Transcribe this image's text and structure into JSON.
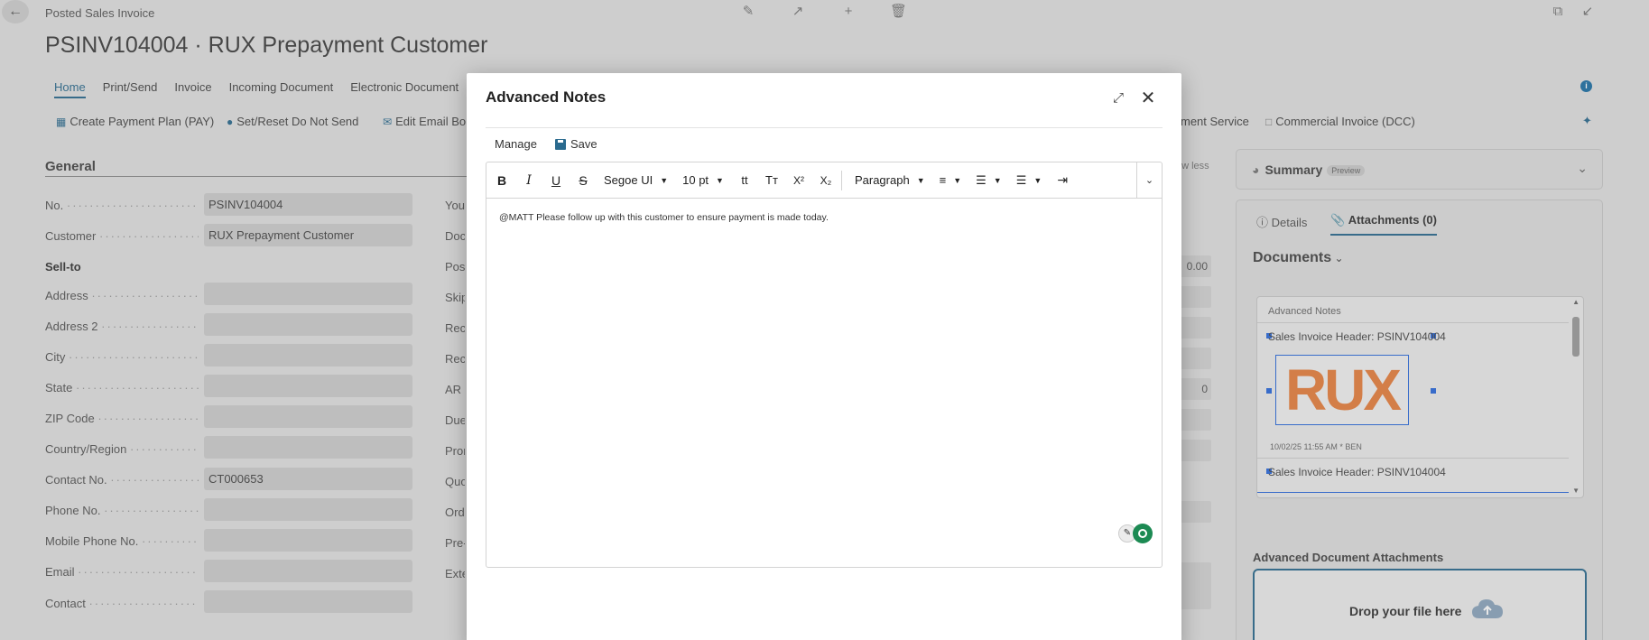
{
  "page": {
    "breadcrumb": "Posted Sales Invoice",
    "title": "PSINV104004 · RUX Prepayment Customer",
    "tabs": [
      "Home",
      "Print/Send",
      "Invoice",
      "Incoming Document",
      "Electronic Document"
    ],
    "actions": [
      "Create Payment Plan (PAY)",
      "Set/Reset Do Not Send",
      "Edit Email Bo",
      "ment Service",
      "Commercial Invoice (DCC)"
    ],
    "section_title": "General",
    "show_less": "ow less",
    "fields": [
      {
        "label": "No.",
        "value": "PSINV104004"
      },
      {
        "label": "Customer",
        "value": "RUX Prepayment Customer"
      },
      {
        "label": "Sell-to",
        "value": ""
      },
      {
        "label": "Address",
        "value": ""
      },
      {
        "label": "Address 2",
        "value": ""
      },
      {
        "label": "City",
        "value": ""
      },
      {
        "label": "State",
        "value": ""
      },
      {
        "label": "ZIP Code",
        "value": ""
      },
      {
        "label": "Country/Region",
        "value": ""
      },
      {
        "label": "Contact No.",
        "value": "CT000653"
      },
      {
        "label": "Phone No.",
        "value": ""
      },
      {
        "label": "Mobile Phone No.",
        "value": ""
      },
      {
        "label": "Email",
        "value": ""
      },
      {
        "label": "Contact",
        "value": ""
      }
    ],
    "col2_labels": [
      "Your",
      "Doc",
      "Post",
      "Skip",
      "Recu",
      "Recu",
      "AR E",
      "Due",
      "Pron",
      "Quo",
      "Orde",
      "Pre-",
      "Exte"
    ],
    "col2_values": [
      "0.00",
      "0"
    ]
  },
  "factbox": {
    "summary_label": "Summary",
    "preview_badge": "Preview",
    "tab_details": "Details",
    "tab_attachments": "Attachments (0)",
    "documents_heading": "Documents",
    "docs_header": "Advanced Notes",
    "doc1_title": "Sales Invoice Header: PSINV104004",
    "doc1_logo_text": "RUX",
    "doc1_stamp": "10/02/25 11:55 AM * BEN",
    "doc2_title": "Sales Invoice Header: PSINV104004",
    "ada_heading": "Advanced Document Attachments",
    "drop_text": "Drop your file here"
  },
  "modal": {
    "title": "Advanced Notes",
    "menu_manage": "Manage",
    "menu_save": "Save",
    "font_family": "Segoe UI",
    "font_size": "10 pt",
    "block_format": "Paragraph",
    "note_text": "@MATT  Please follow up with this customer to ensure payment is made today."
  },
  "icons": {
    "bold": "B",
    "italic": "I",
    "underline": "U",
    "strike": "S",
    "superscript": "X²",
    "subscript": "X₂"
  },
  "colors": {
    "accent": "#2a6a8e",
    "logo_orange": "#e77f3e",
    "badge_green": "#1c8a53"
  }
}
